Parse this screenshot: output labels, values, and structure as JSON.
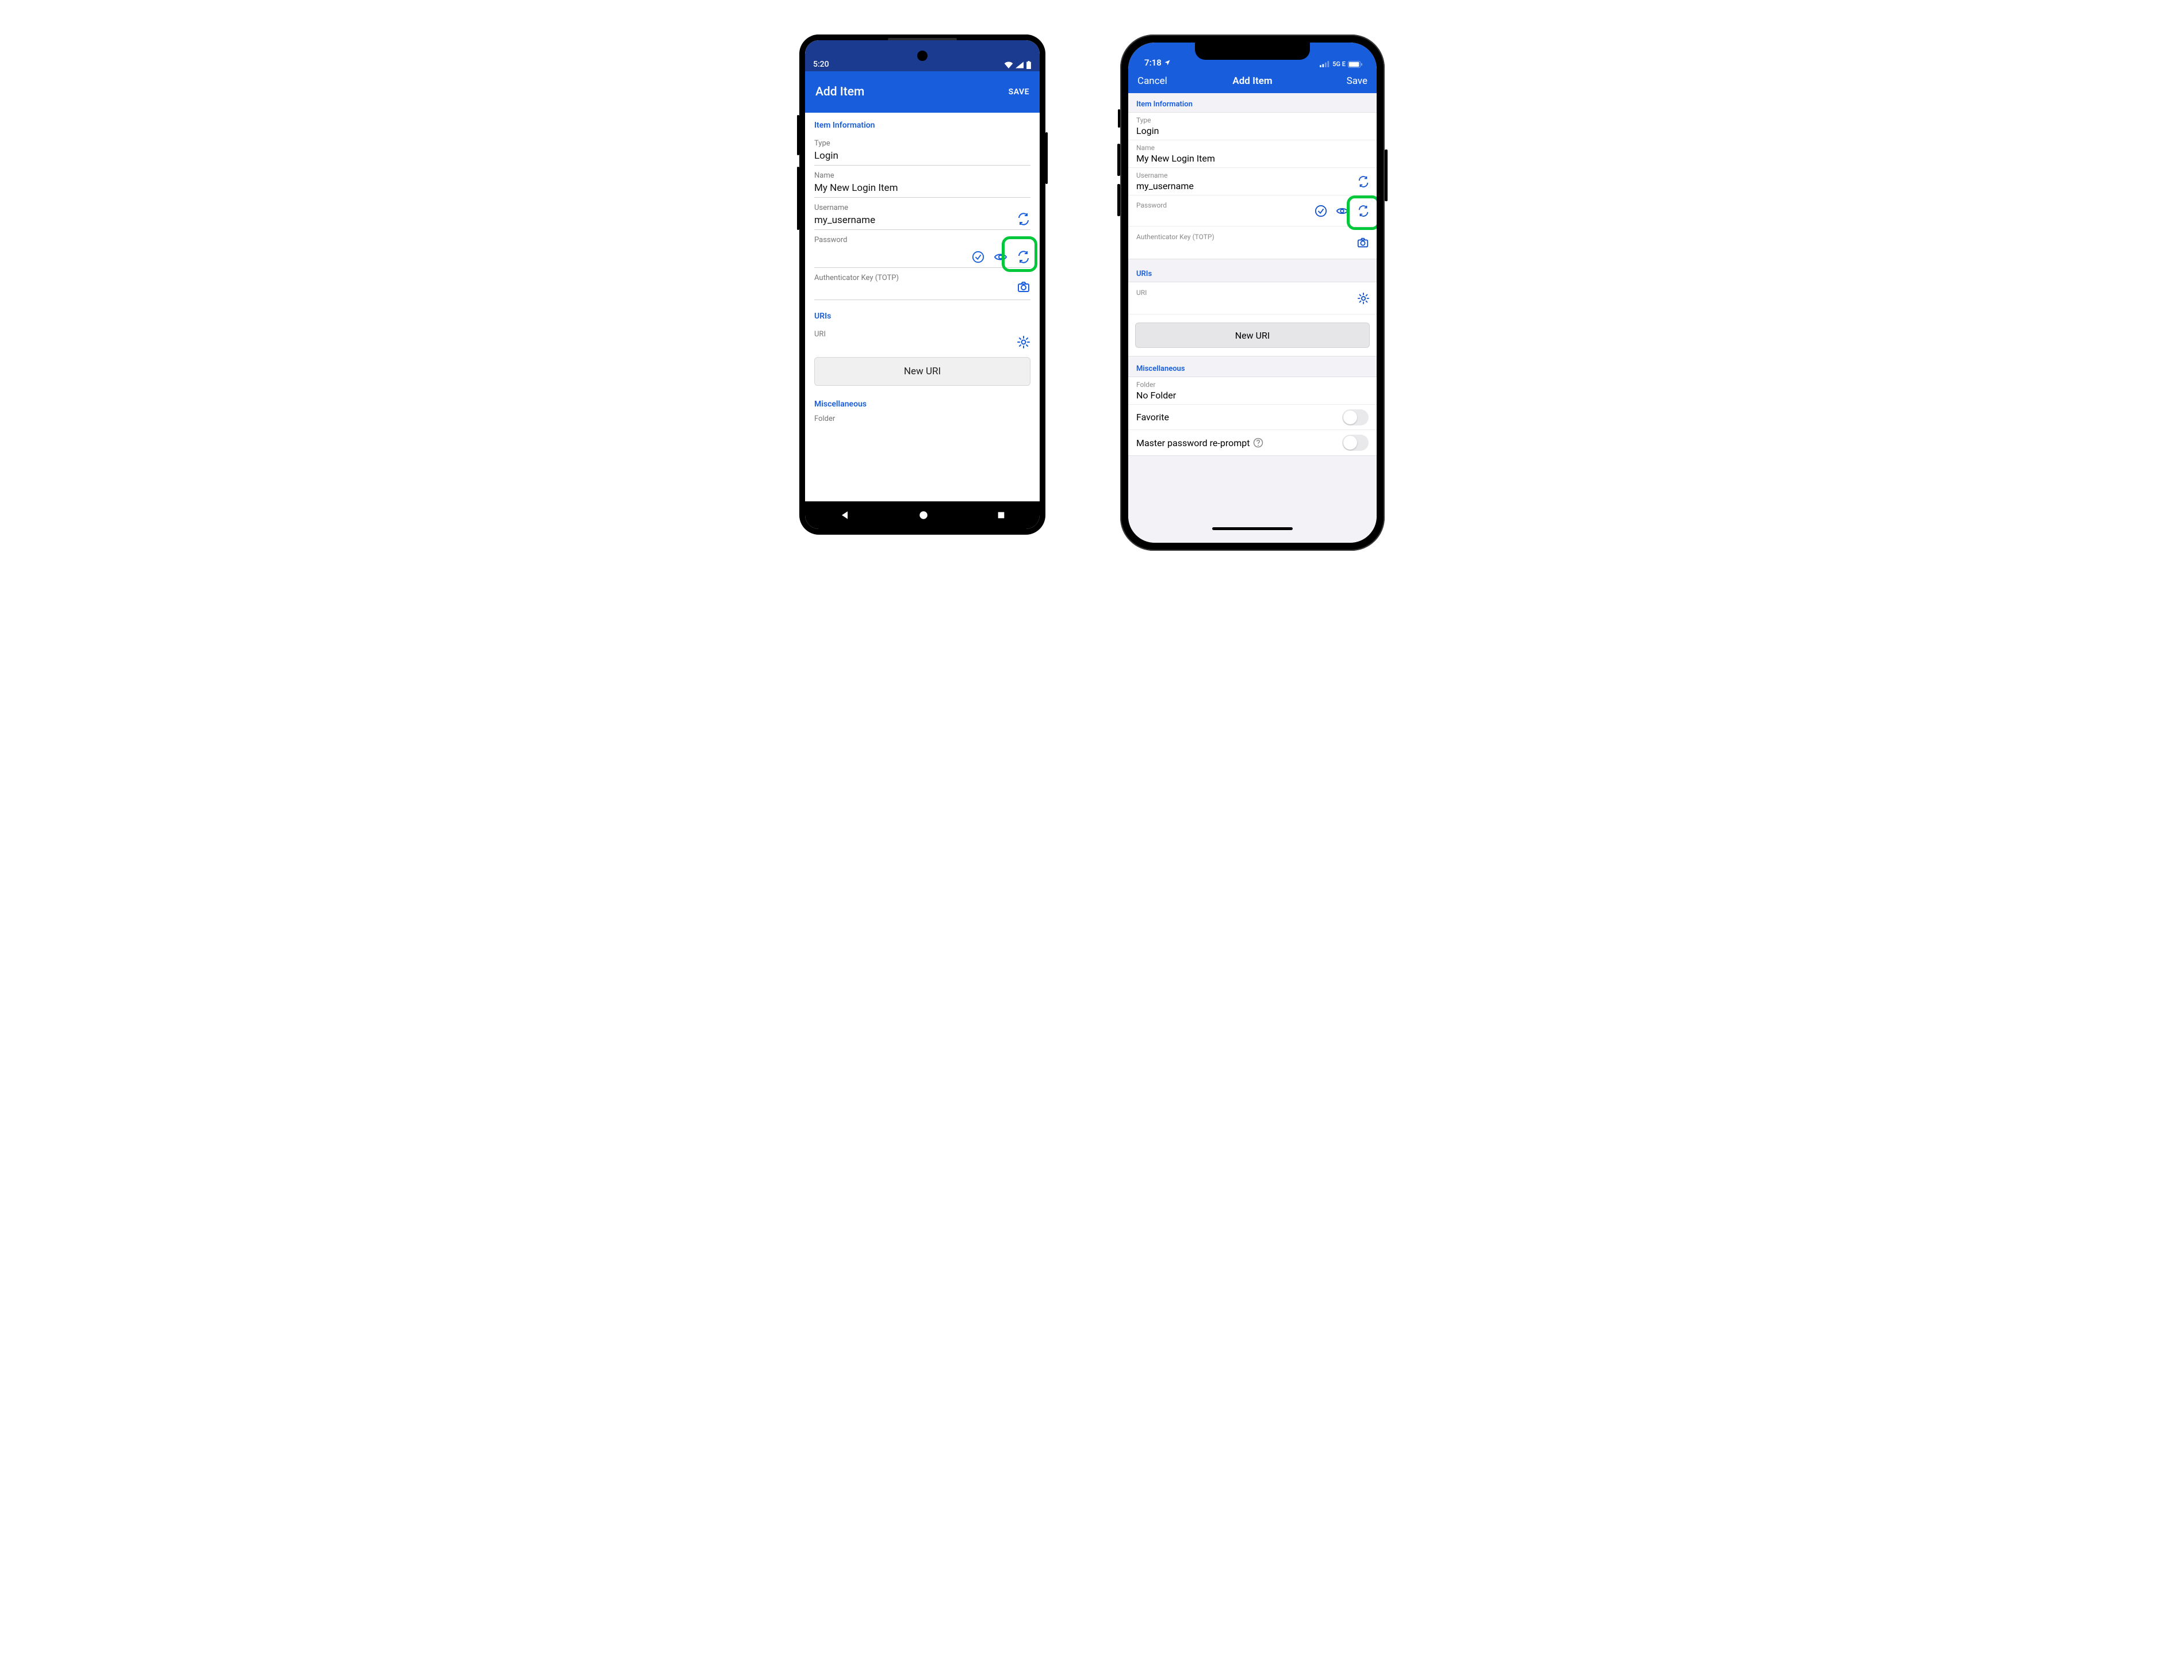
{
  "android": {
    "status": {
      "time": "5:20"
    },
    "appbar": {
      "title": "Add Item",
      "save": "SAVE"
    },
    "section_item_info": "Item Information",
    "type_label": "Type",
    "type_value": "Login",
    "name_label": "Name",
    "name_value": "My New Login Item",
    "username_label": "Username",
    "username_value": "my_username",
    "password_label": "Password",
    "password_value": "",
    "totp_label": "Authenticator Key (TOTP)",
    "section_uris": "URIs",
    "uri_label": "URI",
    "new_uri_btn": "New URI",
    "section_misc": "Miscellaneous",
    "folder_label": "Folder"
  },
  "ios": {
    "status": {
      "time": "7:18",
      "network": "5G E"
    },
    "navbar": {
      "cancel": "Cancel",
      "title": "Add Item",
      "save": "Save"
    },
    "section_item_info": "Item Information",
    "type_label": "Type",
    "type_value": "Login",
    "name_label": "Name",
    "name_value": "My New Login Item",
    "username_label": "Username",
    "username_value": "my_username",
    "password_label": "Password",
    "password_value": "",
    "totp_label": "Authenticator Key (TOTP)",
    "section_uris": "URIs",
    "uri_label": "URI",
    "new_uri_btn": "New URI",
    "section_misc": "Miscellaneous",
    "folder_label": "Folder",
    "folder_value": "No Folder",
    "favorite_label": "Favorite",
    "reprompt_label": "Master password re-prompt"
  }
}
